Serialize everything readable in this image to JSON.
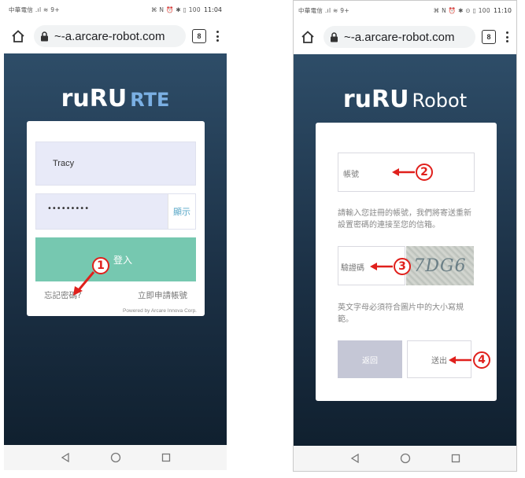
{
  "left_phone": {
    "status": {
      "carrier": "中華電信 .ıl ≋ 9+",
      "icons": "⌘ N ⏰ ✱ ▯ 100",
      "time": "11:04"
    },
    "browser": {
      "url": "~-a.arcare-robot.com",
      "tab_count": "8"
    },
    "logo": {
      "main": "ruRU",
      "sub": "RTE"
    },
    "login": {
      "username_value": "Tracy",
      "password_mask": "•••••••••",
      "show_label": "顯示",
      "login_button": "登入",
      "forgot_link": "忘記密碼?",
      "register_link": "立即申請帳號",
      "footer": "Powered by Arcare Innova Corp."
    },
    "annotation": {
      "number": "1"
    }
  },
  "right_phone": {
    "status": {
      "carrier": "中華電信 .ıl ≋ 9+",
      "icons": "⌘ N ⏰ ✱ ⊙ ▯ 100",
      "time": "11:10"
    },
    "browser": {
      "url": "~-a.arcare-robot.com",
      "tab_count": "8"
    },
    "logo": {
      "main": "ruRU",
      "sub": "Robot"
    },
    "reset": {
      "account_placeholder": "帳號",
      "instructions": "請輸入您註冊的帳號，我們將寄送重新設置密碼的連接至您的信箱。",
      "captcha_placeholder": "驗證碼",
      "captcha_text": "7DG6",
      "captcha_hint": "英文字母必須符合圖片中的大小寫規範。",
      "back_button": "返回",
      "submit_button": "送出"
    },
    "annotations": [
      "2",
      "3",
      "4"
    ]
  },
  "colors": {
    "background_top": "#2e4d68",
    "background_bottom": "#10202f",
    "login_button": "#76c8b0",
    "input_fill": "#e8eaf8",
    "show_link": "#5aa8c8",
    "back_button": "#c5c7d6",
    "annotation_red": "#e0201c"
  },
  "icons": [
    "home-icon",
    "lock-icon",
    "tabs-icon",
    "menu-icon",
    "back-icon",
    "circle-home-icon",
    "recent-apps-icon"
  ]
}
